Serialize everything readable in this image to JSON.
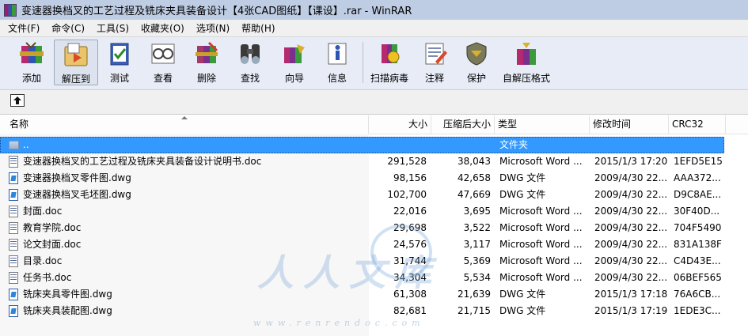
{
  "window": {
    "title": "变速器换档叉的工艺过程及铣床夹具装备设计【4张CAD图纸】【课设】.rar - WinRAR"
  },
  "menu": [
    {
      "label": "文件(F)"
    },
    {
      "label": "命令(C)"
    },
    {
      "label": "工具(S)"
    },
    {
      "label": "收藏夹(O)"
    },
    {
      "label": "选项(N)"
    },
    {
      "label": "帮助(H)"
    }
  ],
  "toolbar": [
    {
      "label": "添加",
      "icon": "add-icon"
    },
    {
      "label": "解压到",
      "icon": "extract-icon",
      "active": true
    },
    {
      "label": "测试",
      "icon": "test-icon"
    },
    {
      "label": "查看",
      "icon": "view-icon"
    },
    {
      "label": "删除",
      "icon": "delete-icon"
    },
    {
      "label": "查找",
      "icon": "find-icon"
    },
    {
      "label": "向导",
      "icon": "wizard-icon"
    },
    {
      "label": "信息",
      "icon": "info-icon"
    },
    {
      "label": "扫描病毒",
      "icon": "virus-scan-icon"
    },
    {
      "label": "注释",
      "icon": "comment-icon"
    },
    {
      "label": "保护",
      "icon": "protect-icon"
    },
    {
      "label": "自解压格式",
      "icon": "sfx-icon"
    }
  ],
  "columns": {
    "name": "名称",
    "size": "大小",
    "packed": "压缩后大小",
    "type": "类型",
    "modified": "修改时间",
    "crc": "CRC32"
  },
  "files": [
    {
      "name": "..",
      "size": "",
      "packed": "",
      "type": "文件夹",
      "modified": "",
      "crc": "",
      "icon": "folder"
    },
    {
      "name": "变速器换档叉的工艺过程及铣床夹具装备设计说明书.doc",
      "size": "291,528",
      "packed": "38,043",
      "type": "Microsoft Word ...",
      "modified": "2015/1/3 17:20",
      "crc": "1EFD5E15",
      "icon": "doc"
    },
    {
      "name": "变速器换档叉零件图.dwg",
      "size": "98,156",
      "packed": "42,658",
      "type": "DWG 文件",
      "modified": "2009/4/30 22...",
      "crc": "AAA372...",
      "icon": "dwg"
    },
    {
      "name": "变速器换档叉毛坯图.dwg",
      "size": "102,700",
      "packed": "47,669",
      "type": "DWG 文件",
      "modified": "2009/4/30 22...",
      "crc": "D9C8AE...",
      "icon": "dwg"
    },
    {
      "name": "封面.doc",
      "size": "22,016",
      "packed": "3,695",
      "type": "Microsoft Word ...",
      "modified": "2009/4/30 22...",
      "crc": "30F40D...",
      "icon": "doc"
    },
    {
      "name": "教育学院.doc",
      "size": "29,698",
      "packed": "3,522",
      "type": "Microsoft Word ...",
      "modified": "2009/4/30 22...",
      "crc": "704F5490",
      "icon": "doc"
    },
    {
      "name": "论文封面.doc",
      "size": "24,576",
      "packed": "3,117",
      "type": "Microsoft Word ...",
      "modified": "2009/4/30 22...",
      "crc": "831A138F",
      "icon": "doc"
    },
    {
      "name": "目录.doc",
      "size": "31,744",
      "packed": "5,369",
      "type": "Microsoft Word ...",
      "modified": "2009/4/30 22...",
      "crc": "C4D43E...",
      "icon": "doc"
    },
    {
      "name": "任务书.doc",
      "size": "34,304",
      "packed": "5,534",
      "type": "Microsoft Word ...",
      "modified": "2009/4/30 22...",
      "crc": "06BEF565",
      "icon": "doc"
    },
    {
      "name": "铣床夹具零件图.dwg",
      "size": "61,308",
      "packed": "21,639",
      "type": "DWG 文件",
      "modified": "2015/1/3 17:18",
      "crc": "76A6CB...",
      "icon": "dwg"
    },
    {
      "name": "铣床夹具装配图.dwg",
      "size": "82,681",
      "packed": "21,715",
      "type": "DWG 文件",
      "modified": "2015/1/3 17:19",
      "crc": "1EDE3C...",
      "icon": "dwg"
    }
  ],
  "watermark": {
    "big": "人人文库",
    "small": "www.renrendoc.com"
  }
}
